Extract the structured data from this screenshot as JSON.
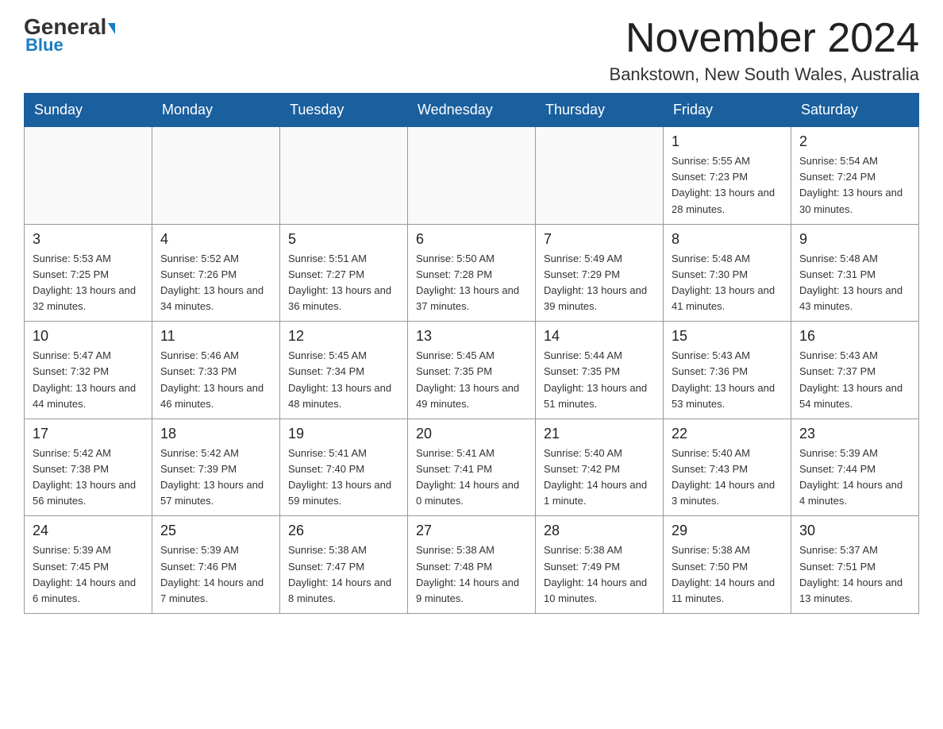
{
  "header": {
    "logo_text_general": "General",
    "logo_text_blue": "Blue",
    "main_title": "November 2024",
    "subtitle": "Bankstown, New South Wales, Australia"
  },
  "days_of_week": [
    "Sunday",
    "Monday",
    "Tuesday",
    "Wednesday",
    "Thursday",
    "Friday",
    "Saturday"
  ],
  "weeks": [
    [
      {
        "day": "",
        "info": ""
      },
      {
        "day": "",
        "info": ""
      },
      {
        "day": "",
        "info": ""
      },
      {
        "day": "",
        "info": ""
      },
      {
        "day": "",
        "info": ""
      },
      {
        "day": "1",
        "info": "Sunrise: 5:55 AM\nSunset: 7:23 PM\nDaylight: 13 hours and 28 minutes."
      },
      {
        "day": "2",
        "info": "Sunrise: 5:54 AM\nSunset: 7:24 PM\nDaylight: 13 hours and 30 minutes."
      }
    ],
    [
      {
        "day": "3",
        "info": "Sunrise: 5:53 AM\nSunset: 7:25 PM\nDaylight: 13 hours and 32 minutes."
      },
      {
        "day": "4",
        "info": "Sunrise: 5:52 AM\nSunset: 7:26 PM\nDaylight: 13 hours and 34 minutes."
      },
      {
        "day": "5",
        "info": "Sunrise: 5:51 AM\nSunset: 7:27 PM\nDaylight: 13 hours and 36 minutes."
      },
      {
        "day": "6",
        "info": "Sunrise: 5:50 AM\nSunset: 7:28 PM\nDaylight: 13 hours and 37 minutes."
      },
      {
        "day": "7",
        "info": "Sunrise: 5:49 AM\nSunset: 7:29 PM\nDaylight: 13 hours and 39 minutes."
      },
      {
        "day": "8",
        "info": "Sunrise: 5:48 AM\nSunset: 7:30 PM\nDaylight: 13 hours and 41 minutes."
      },
      {
        "day": "9",
        "info": "Sunrise: 5:48 AM\nSunset: 7:31 PM\nDaylight: 13 hours and 43 minutes."
      }
    ],
    [
      {
        "day": "10",
        "info": "Sunrise: 5:47 AM\nSunset: 7:32 PM\nDaylight: 13 hours and 44 minutes."
      },
      {
        "day": "11",
        "info": "Sunrise: 5:46 AM\nSunset: 7:33 PM\nDaylight: 13 hours and 46 minutes."
      },
      {
        "day": "12",
        "info": "Sunrise: 5:45 AM\nSunset: 7:34 PM\nDaylight: 13 hours and 48 minutes."
      },
      {
        "day": "13",
        "info": "Sunrise: 5:45 AM\nSunset: 7:35 PM\nDaylight: 13 hours and 49 minutes."
      },
      {
        "day": "14",
        "info": "Sunrise: 5:44 AM\nSunset: 7:35 PM\nDaylight: 13 hours and 51 minutes."
      },
      {
        "day": "15",
        "info": "Sunrise: 5:43 AM\nSunset: 7:36 PM\nDaylight: 13 hours and 53 minutes."
      },
      {
        "day": "16",
        "info": "Sunrise: 5:43 AM\nSunset: 7:37 PM\nDaylight: 13 hours and 54 minutes."
      }
    ],
    [
      {
        "day": "17",
        "info": "Sunrise: 5:42 AM\nSunset: 7:38 PM\nDaylight: 13 hours and 56 minutes."
      },
      {
        "day": "18",
        "info": "Sunrise: 5:42 AM\nSunset: 7:39 PM\nDaylight: 13 hours and 57 minutes."
      },
      {
        "day": "19",
        "info": "Sunrise: 5:41 AM\nSunset: 7:40 PM\nDaylight: 13 hours and 59 minutes."
      },
      {
        "day": "20",
        "info": "Sunrise: 5:41 AM\nSunset: 7:41 PM\nDaylight: 14 hours and 0 minutes."
      },
      {
        "day": "21",
        "info": "Sunrise: 5:40 AM\nSunset: 7:42 PM\nDaylight: 14 hours and 1 minute."
      },
      {
        "day": "22",
        "info": "Sunrise: 5:40 AM\nSunset: 7:43 PM\nDaylight: 14 hours and 3 minutes."
      },
      {
        "day": "23",
        "info": "Sunrise: 5:39 AM\nSunset: 7:44 PM\nDaylight: 14 hours and 4 minutes."
      }
    ],
    [
      {
        "day": "24",
        "info": "Sunrise: 5:39 AM\nSunset: 7:45 PM\nDaylight: 14 hours and 6 minutes."
      },
      {
        "day": "25",
        "info": "Sunrise: 5:39 AM\nSunset: 7:46 PM\nDaylight: 14 hours and 7 minutes."
      },
      {
        "day": "26",
        "info": "Sunrise: 5:38 AM\nSunset: 7:47 PM\nDaylight: 14 hours and 8 minutes."
      },
      {
        "day": "27",
        "info": "Sunrise: 5:38 AM\nSunset: 7:48 PM\nDaylight: 14 hours and 9 minutes."
      },
      {
        "day": "28",
        "info": "Sunrise: 5:38 AM\nSunset: 7:49 PM\nDaylight: 14 hours and 10 minutes."
      },
      {
        "day": "29",
        "info": "Sunrise: 5:38 AM\nSunset: 7:50 PM\nDaylight: 14 hours and 11 minutes."
      },
      {
        "day": "30",
        "info": "Sunrise: 5:37 AM\nSunset: 7:51 PM\nDaylight: 14 hours and 13 minutes."
      }
    ]
  ]
}
